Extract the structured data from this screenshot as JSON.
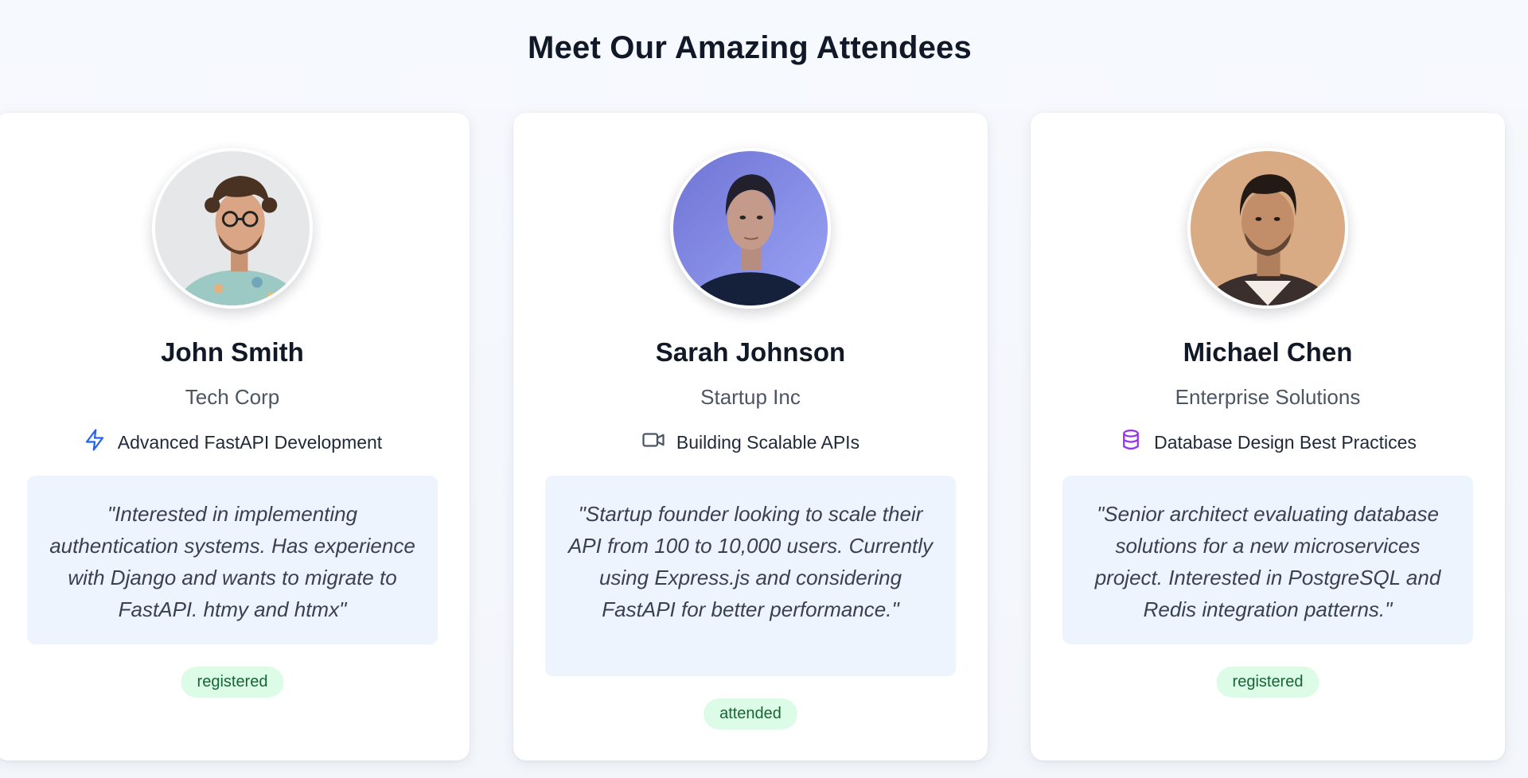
{
  "page": {
    "title": "Meet Our Amazing Attendees"
  },
  "attendees": [
    {
      "name": "John Smith",
      "company": "Tech Corp",
      "topic": "Advanced FastAPI Development",
      "topic_icon": "lightning-icon",
      "topic_icon_color": "#2563eb",
      "quote": "\"Interested in implementing authentication systems. Has experience with Django and wants to migrate to FastAPI. htmy and htmx\"",
      "status": "registered"
    },
    {
      "name": "Sarah Johnson",
      "company": "Startup Inc",
      "topic": "Building Scalable APIs",
      "topic_icon": "video-icon",
      "topic_icon_color": "#4b5563",
      "quote": "\"Startup founder looking to scale their API from 100 to 10,000 users. Currently using Express.js and considering FastAPI for better performance.\"",
      "status": "attended"
    },
    {
      "name": "Michael Chen",
      "company": "Enterprise Solutions",
      "topic": "Database Design Best Practices",
      "topic_icon": "database-icon",
      "topic_icon_color": "#9333ea",
      "quote": "\"Senior architect evaluating database solutions for a new microservices project. Interested in PostgreSQL and Redis integration patterns.\"",
      "status": "registered"
    }
  ],
  "colors": {
    "status_bg": "#dcfce7",
    "status_text": "#166534",
    "quote_bg": "#eef4fe"
  }
}
